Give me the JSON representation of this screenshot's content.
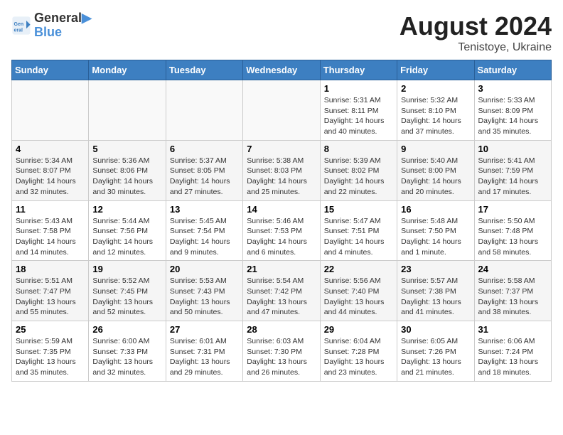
{
  "logo": {
    "line1": "General",
    "line2": "Blue"
  },
  "title": "August 2024",
  "subtitle": "Tenistoye, Ukraine",
  "days_of_week": [
    "Sunday",
    "Monday",
    "Tuesday",
    "Wednesday",
    "Thursday",
    "Friday",
    "Saturday"
  ],
  "weeks": [
    [
      {
        "day": "",
        "info": ""
      },
      {
        "day": "",
        "info": ""
      },
      {
        "day": "",
        "info": ""
      },
      {
        "day": "",
        "info": ""
      },
      {
        "day": "1",
        "info": "Sunrise: 5:31 AM\nSunset: 8:11 PM\nDaylight: 14 hours\nand 40 minutes."
      },
      {
        "day": "2",
        "info": "Sunrise: 5:32 AM\nSunset: 8:10 PM\nDaylight: 14 hours\nand 37 minutes."
      },
      {
        "day": "3",
        "info": "Sunrise: 5:33 AM\nSunset: 8:09 PM\nDaylight: 14 hours\nand 35 minutes."
      }
    ],
    [
      {
        "day": "4",
        "info": "Sunrise: 5:34 AM\nSunset: 8:07 PM\nDaylight: 14 hours\nand 32 minutes."
      },
      {
        "day": "5",
        "info": "Sunrise: 5:36 AM\nSunset: 8:06 PM\nDaylight: 14 hours\nand 30 minutes."
      },
      {
        "day": "6",
        "info": "Sunrise: 5:37 AM\nSunset: 8:05 PM\nDaylight: 14 hours\nand 27 minutes."
      },
      {
        "day": "7",
        "info": "Sunrise: 5:38 AM\nSunset: 8:03 PM\nDaylight: 14 hours\nand 25 minutes."
      },
      {
        "day": "8",
        "info": "Sunrise: 5:39 AM\nSunset: 8:02 PM\nDaylight: 14 hours\nand 22 minutes."
      },
      {
        "day": "9",
        "info": "Sunrise: 5:40 AM\nSunset: 8:00 PM\nDaylight: 14 hours\nand 20 minutes."
      },
      {
        "day": "10",
        "info": "Sunrise: 5:41 AM\nSunset: 7:59 PM\nDaylight: 14 hours\nand 17 minutes."
      }
    ],
    [
      {
        "day": "11",
        "info": "Sunrise: 5:43 AM\nSunset: 7:58 PM\nDaylight: 14 hours\nand 14 minutes."
      },
      {
        "day": "12",
        "info": "Sunrise: 5:44 AM\nSunset: 7:56 PM\nDaylight: 14 hours\nand 12 minutes."
      },
      {
        "day": "13",
        "info": "Sunrise: 5:45 AM\nSunset: 7:54 PM\nDaylight: 14 hours\nand 9 minutes."
      },
      {
        "day": "14",
        "info": "Sunrise: 5:46 AM\nSunset: 7:53 PM\nDaylight: 14 hours\nand 6 minutes."
      },
      {
        "day": "15",
        "info": "Sunrise: 5:47 AM\nSunset: 7:51 PM\nDaylight: 14 hours\nand 4 minutes."
      },
      {
        "day": "16",
        "info": "Sunrise: 5:48 AM\nSunset: 7:50 PM\nDaylight: 14 hours\nand 1 minute."
      },
      {
        "day": "17",
        "info": "Sunrise: 5:50 AM\nSunset: 7:48 PM\nDaylight: 13 hours\nand 58 minutes."
      }
    ],
    [
      {
        "day": "18",
        "info": "Sunrise: 5:51 AM\nSunset: 7:47 PM\nDaylight: 13 hours\nand 55 minutes."
      },
      {
        "day": "19",
        "info": "Sunrise: 5:52 AM\nSunset: 7:45 PM\nDaylight: 13 hours\nand 52 minutes."
      },
      {
        "day": "20",
        "info": "Sunrise: 5:53 AM\nSunset: 7:43 PM\nDaylight: 13 hours\nand 50 minutes."
      },
      {
        "day": "21",
        "info": "Sunrise: 5:54 AM\nSunset: 7:42 PM\nDaylight: 13 hours\nand 47 minutes."
      },
      {
        "day": "22",
        "info": "Sunrise: 5:56 AM\nSunset: 7:40 PM\nDaylight: 13 hours\nand 44 minutes."
      },
      {
        "day": "23",
        "info": "Sunrise: 5:57 AM\nSunset: 7:38 PM\nDaylight: 13 hours\nand 41 minutes."
      },
      {
        "day": "24",
        "info": "Sunrise: 5:58 AM\nSunset: 7:37 PM\nDaylight: 13 hours\nand 38 minutes."
      }
    ],
    [
      {
        "day": "25",
        "info": "Sunrise: 5:59 AM\nSunset: 7:35 PM\nDaylight: 13 hours\nand 35 minutes."
      },
      {
        "day": "26",
        "info": "Sunrise: 6:00 AM\nSunset: 7:33 PM\nDaylight: 13 hours\nand 32 minutes."
      },
      {
        "day": "27",
        "info": "Sunrise: 6:01 AM\nSunset: 7:31 PM\nDaylight: 13 hours\nand 29 minutes."
      },
      {
        "day": "28",
        "info": "Sunrise: 6:03 AM\nSunset: 7:30 PM\nDaylight: 13 hours\nand 26 minutes."
      },
      {
        "day": "29",
        "info": "Sunrise: 6:04 AM\nSunset: 7:28 PM\nDaylight: 13 hours\nand 23 minutes."
      },
      {
        "day": "30",
        "info": "Sunrise: 6:05 AM\nSunset: 7:26 PM\nDaylight: 13 hours\nand 21 minutes."
      },
      {
        "day": "31",
        "info": "Sunrise: 6:06 AM\nSunset: 7:24 PM\nDaylight: 13 hours\nand 18 minutes."
      }
    ]
  ]
}
